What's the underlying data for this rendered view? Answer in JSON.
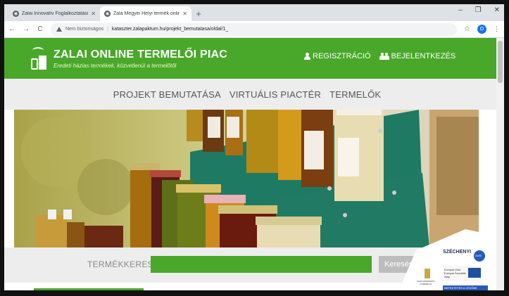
{
  "browser": {
    "tabs": [
      {
        "title": "Zalai Innovatív Foglalkoztatási Pa",
        "active": false
      },
      {
        "title": "Zala Megyei Helyi termék onlin...",
        "active": true
      }
    ],
    "new_tab": "+",
    "security_label": "Nem biztonságos",
    "url": "kataszter.zalapaktum.hu/projekt_bemutatasa/oldal/1_",
    "profile_initial": "O",
    "controls": {
      "minimize": "–",
      "maximize": "❐",
      "close": "✕"
    },
    "nav": {
      "back": "←",
      "forward": "→",
      "reload": "C"
    }
  },
  "site": {
    "brand_title": "ZALAI ONLINE TERMELŐI PIAC",
    "brand_subtitle": "Eredeti házias termékek, közvetlenül a termelőtől",
    "auth": {
      "register": "REGISZTRÁCIÓ",
      "login": "BEJELENTKEZÉS"
    },
    "nav": [
      "PROJEKT BEMUTATÁSA",
      "VIRTUÁLIS PIACTÉR",
      "TERMELŐK"
    ],
    "search": {
      "label": "TERMÉKKERESŐ",
      "input_value": "",
      "button_label": "Keresés"
    },
    "badge": {
      "title": "SZÉCHENYI",
      "suffix": "2020",
      "eu_text": "Európai Unió Európai Szociális Alap",
      "footer": "BEFEKTETÉS A JÖVŐBE",
      "gov": "MAGYARORSZÁG KORMÁNYA"
    }
  },
  "colors": {
    "brand_green": "#49a82a",
    "nav_bg": "#ededed",
    "eu_blue": "#1f4fa0"
  }
}
